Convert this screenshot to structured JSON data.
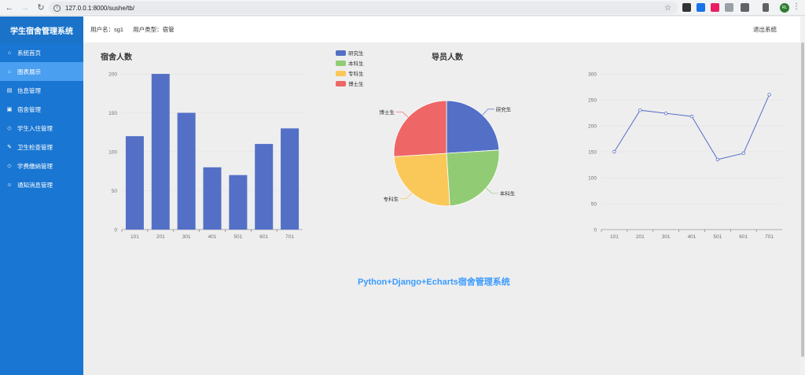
{
  "browser": {
    "url": "127.0.0.1:8000/sushe/tb/"
  },
  "sidebar": {
    "brand": "学生宿舍管理系统",
    "items": [
      {
        "label": "系统首页",
        "icon": "home-icon",
        "glyph": "⌂",
        "active": false
      },
      {
        "label": "图表展示",
        "icon": "chart-icon",
        "glyph": "⌂",
        "active": true
      },
      {
        "label": "信息管理",
        "icon": "document-icon",
        "glyph": "▤",
        "active": false
      },
      {
        "label": "宿舍管理",
        "icon": "id-card-icon",
        "glyph": "▣",
        "active": false
      },
      {
        "label": "学生入住管理",
        "icon": "diamond-icon",
        "glyph": "◇",
        "active": false
      },
      {
        "label": "卫生检查管理",
        "icon": "brush-icon",
        "glyph": "✎",
        "active": false
      },
      {
        "label": "学费缴纳管理",
        "icon": "diamond-icon",
        "glyph": "◇",
        "active": false
      },
      {
        "label": "通知消息管理",
        "icon": "users-icon",
        "glyph": "☺",
        "active": false
      }
    ]
  },
  "header": {
    "user_label": "用户名：sg1",
    "role_label": "用户类型：宿管",
    "logout": "退出系统"
  },
  "footer_title": "Python+Django+Echarts宿舍管理系统",
  "colors": {
    "sidebar": "#1976d2",
    "active": "#4a9ff0",
    "series": "#5470c6",
    "pie": [
      "#5470c6",
      "#91cc75",
      "#fac858",
      "#ee6666"
    ]
  },
  "chart_data": [
    {
      "type": "bar",
      "title": "宿舍人数",
      "categories": [
        "101",
        "201",
        "301",
        "401",
        "501",
        "601",
        "701"
      ],
      "values": [
        120,
        200,
        150,
        80,
        70,
        110,
        130
      ],
      "ylim": [
        0,
        200
      ],
      "yticks": [
        0,
        50,
        100,
        150,
        200
      ]
    },
    {
      "type": "pie",
      "title": "导员人数",
      "legend_position": "top-left",
      "slices": [
        {
          "name": "研究生",
          "value": 24
        },
        {
          "name": "本科生",
          "value": 25
        },
        {
          "name": "专科生",
          "value": 25
        },
        {
          "name": "博士生",
          "value": 26
        }
      ]
    },
    {
      "type": "line",
      "title": "",
      "categories": [
        "101",
        "201",
        "301",
        "401",
        "501",
        "601",
        "701"
      ],
      "values": [
        150,
        230,
        224,
        218,
        135,
        147,
        260
      ],
      "ylim": [
        0,
        300
      ],
      "yticks": [
        0,
        50,
        100,
        150,
        200,
        250,
        300
      ]
    }
  ]
}
